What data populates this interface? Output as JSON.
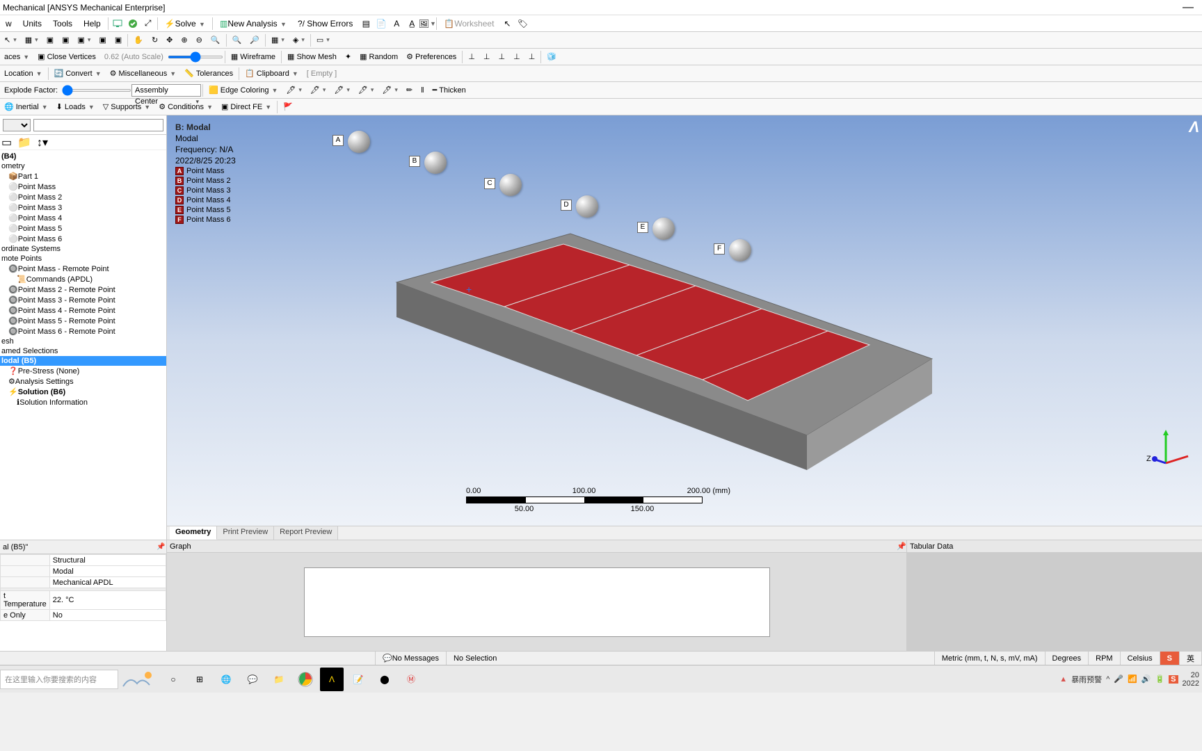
{
  "title": "Mechanical [ANSYS Mechanical Enterprise]",
  "menubar": [
    "w",
    "Units",
    "Tools",
    "Help"
  ],
  "ribbon": {
    "solve": "Solve",
    "new_analysis": "New Analysis",
    "show_errors": "?/ Show Errors",
    "worksheet": "Worksheet"
  },
  "tb2": {
    "close_vertices": "Close Vertices",
    "auto_scale": "0.62 (Auto Scale)",
    "wireframe": "Wireframe",
    "show_mesh": "Show Mesh",
    "random": "Random",
    "preferences": "Preferences"
  },
  "tb3": {
    "location": "Location",
    "convert": "Convert",
    "miscellaneous": "Miscellaneous",
    "tolerances": "Tolerances",
    "clipboard": "Clipboard",
    "empty": "[ Empty ]"
  },
  "tb4": {
    "explode": "Explode Factor:",
    "assembly_center": "Assembly Center",
    "edge_coloring": "Edge Coloring",
    "thicken": "Thicken"
  },
  "tb5": {
    "inertial": "Inertial",
    "loads": "Loads",
    "supports": "Supports",
    "conditions": "Conditions",
    "direct_fe": "Direct FE"
  },
  "tree": {
    "root": "(B4)",
    "items": [
      "ometry",
      "Part 1",
      "Point Mass",
      "Point Mass 2",
      "Point Mass 3",
      "Point Mass 4",
      "Point Mass 5",
      "Point Mass 6",
      "ordinate Systems",
      "mote Points",
      "Point Mass - Remote Point",
      "Commands (APDL)",
      "Point Mass 2 - Remote Point",
      "Point Mass 3 - Remote Point",
      "Point Mass 4 - Remote Point",
      "Point Mass 5 - Remote Point",
      "Point Mass 6 - Remote Point",
      "esh",
      "amed Selections",
      "lodal (B5)",
      "Pre-Stress (None)",
      "Analysis Settings",
      "Solution (B6)",
      "Solution Information"
    ]
  },
  "props": {
    "header": "al (B5)\"",
    "rows": [
      [
        "",
        "Structural"
      ],
      [
        "",
        "Modal"
      ],
      [
        "",
        "Mechanical APDL"
      ],
      [
        "t Temperature",
        "22. °C"
      ],
      [
        "e Only",
        "No"
      ]
    ]
  },
  "overlay": {
    "title": "B: Modal",
    "l1": "Modal",
    "l2": "Frequency: N/A",
    "l3": "2022/8/25 20:23"
  },
  "legend": [
    {
      "t": "A",
      "c": "#a01818",
      "label": "Point Mass"
    },
    {
      "t": "B",
      "c": "#a01818",
      "label": "Point Mass 2"
    },
    {
      "t": "C",
      "c": "#a01818",
      "label": "Point Mass 3"
    },
    {
      "t": "D",
      "c": "#a01818",
      "label": "Point Mass 4"
    },
    {
      "t": "E",
      "c": "#a01818",
      "label": "Point Mass 5"
    },
    {
      "t": "F",
      "c": "#a01818",
      "label": "Point Mass 6"
    }
  ],
  "scale": {
    "top": [
      "0.00",
      "100.00",
      "200.00 (mm)"
    ],
    "bottom": [
      "50.00",
      "150.00"
    ]
  },
  "vptabs": [
    "Geometry",
    "Print Preview",
    "Report Preview"
  ],
  "graph": "Graph",
  "tabular": "Tabular Data",
  "status": {
    "msg": "No Messages",
    "sel": "No Selection",
    "units": "Metric (mm, t, N, s, mV, mA)",
    "deg": "Degrees",
    "rpm": "RPM",
    "cel": "Celsius"
  },
  "taskbar": {
    "search_ph": "在这里输入你要搜索的内容",
    "weather": "暴雨预警",
    "time": "20",
    "date": "2022",
    "lang": "英"
  },
  "triad_z": "Z"
}
